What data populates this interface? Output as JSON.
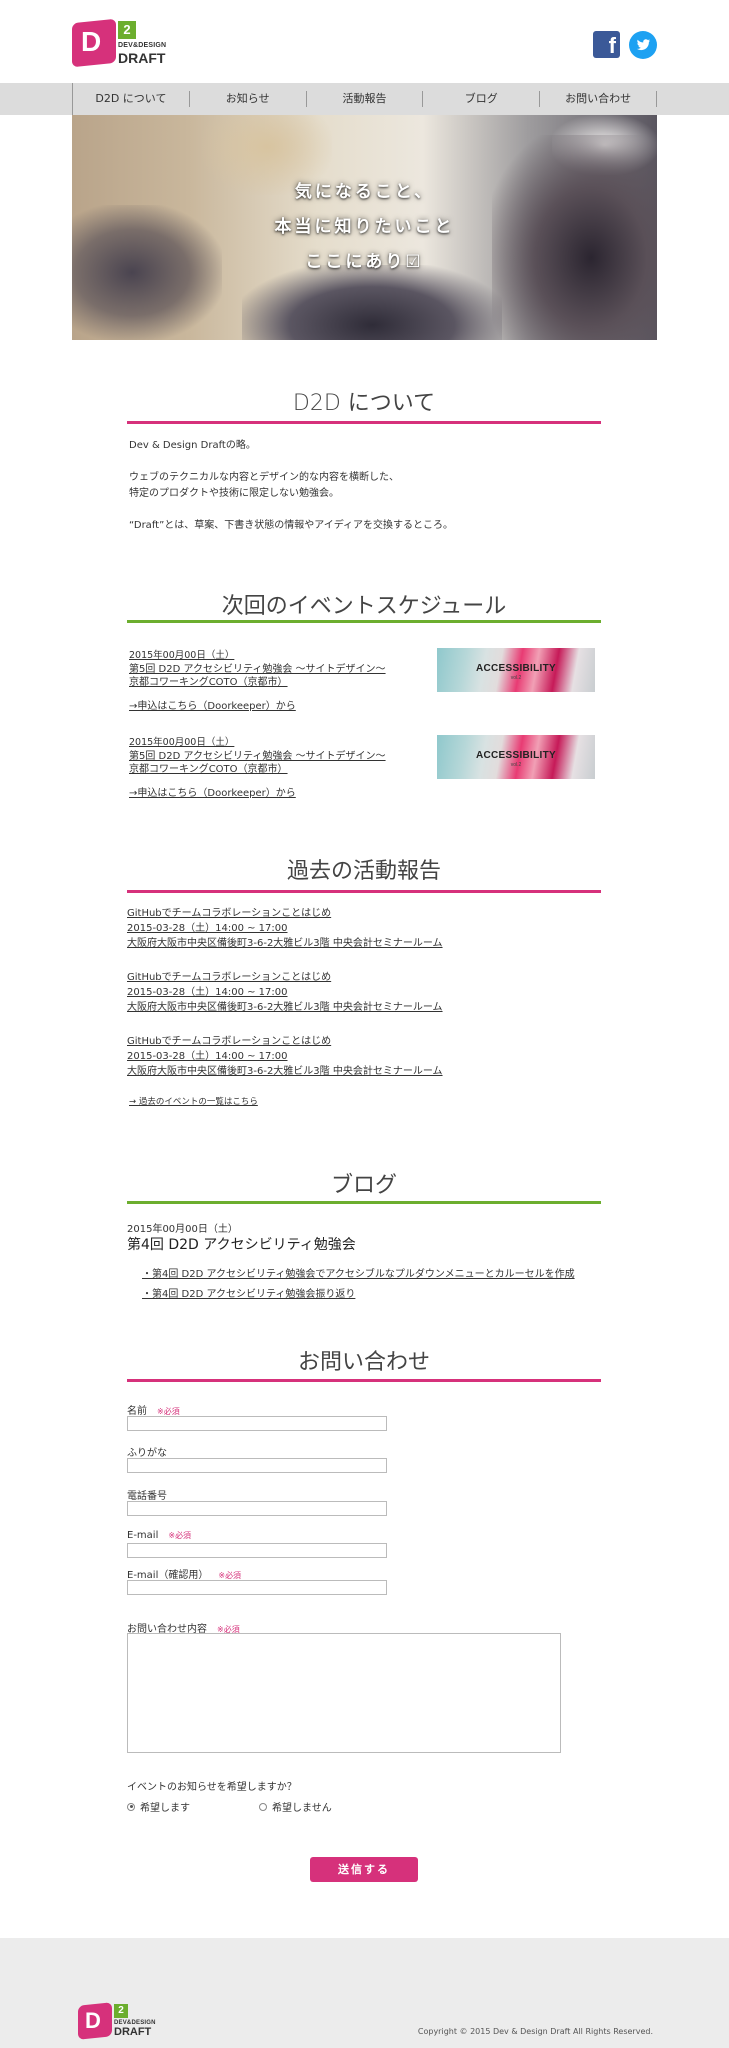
{
  "brand": {
    "logo_letter": "D",
    "logo_number": "2",
    "logo_sub": "DEV&DESIGN",
    "logo_main": "DRAFT",
    "pink": "#d6317b",
    "green": "#6cae2e"
  },
  "social": {
    "facebook_icon": "facebook-icon",
    "facebook_glyph": "f",
    "twitter_icon": "twitter-icon"
  },
  "nav": {
    "items": [
      {
        "label": "D2D について"
      },
      {
        "label": "お知らせ"
      },
      {
        "label": "活動報告"
      },
      {
        "label": "ブログ"
      },
      {
        "label": "お問い合わせ"
      }
    ]
  },
  "hero": {
    "line1": "気になること、",
    "line2": "本当に知りたいこと",
    "line3": "ここにあり☑"
  },
  "about": {
    "title": "D2D について",
    "p1": "Dev & Design Draftの略。",
    "p2a": "ウェブのテクニカルな内容とデザイン的な内容を横断した、",
    "p2b": "特定のプロダクトや技術に限定しない勉強会。",
    "p3": "“Draft”とは、草案、下書き状態の情報やアイディアを交換するところ。"
  },
  "schedule": {
    "title": "次回のイベントスケジュール",
    "events": [
      {
        "date": "2015年00月00日（土）",
        "name": "第5回 D2D アクセシビリティ勉強会 ～サイトデザイン～",
        "place": "京都コワーキングCOTO（京都市）",
        "link": "→申込はこちら（Doorkeeper）から",
        "thumb_label": "ACCESSIBILITY",
        "thumb_sub": "vol.2"
      },
      {
        "date": "2015年00月00日（土）",
        "name": "第5回 D2D アクセシビリティ勉強会 ～サイトデザイン～",
        "place": "京都コワーキングCOTO（京都市）",
        "link": "→申込はこちら（Doorkeeper）から",
        "thumb_label": "ACCESSIBILITY",
        "thumb_sub": "vol.2"
      }
    ]
  },
  "reports": {
    "title": "過去の活動報告",
    "items": [
      {
        "name": "GitHubでチームコラボレーションことはじめ",
        "datetime": "2015-03-28（土）14:00 ~ 17:00",
        "place": "大阪府大阪市中央区備後町3-6-2大雅ビル3階 中央会計セミナールーム"
      },
      {
        "name": "GitHubでチームコラボレーションことはじめ",
        "datetime": "2015-03-28（土）14:00 ~ 17:00",
        "place": "大阪府大阪市中央区備後町3-6-2大雅ビル3階 中央会計セミナールーム"
      },
      {
        "name": "GitHubでチームコラボレーションことはじめ",
        "datetime": "2015-03-28（土）14:00 ~ 17:00",
        "place": "大阪府大阪市中央区備後町3-6-2大雅ビル3階 中央会計セミナールーム"
      }
    ],
    "more_link": "→ 過去のイベントの一覧はこちら"
  },
  "blog": {
    "title": "ブログ",
    "date": "2015年00月00日（土）",
    "heading": "第4回 D2D アクセシビリティ勉強会",
    "posts": [
      "・第4回 D2D アクセシビリティ勉強会でアクセシブルなプルダウンメニューとカルーセルを作成",
      "・第4回 D2D アクセシビリティ勉強会振り返り"
    ]
  },
  "contact": {
    "title": "お問い合わせ",
    "required_mark": "※必須",
    "name_label": "名前",
    "furigana_label": "ふりがな",
    "phone_label": "電話番号",
    "email_label": "E-mail",
    "email_confirm_label": "E-mail（確認用）",
    "message_label": "お問い合わせ内容",
    "notify_question": "イベントのお知らせを希望しますか？",
    "notify_yes": "希望します",
    "notify_no": "希望しません",
    "submit_label": "送信する"
  },
  "footer": {
    "copyright": "Copyright ©  2015 Dev & Design Draft  All Rights Reserved."
  }
}
